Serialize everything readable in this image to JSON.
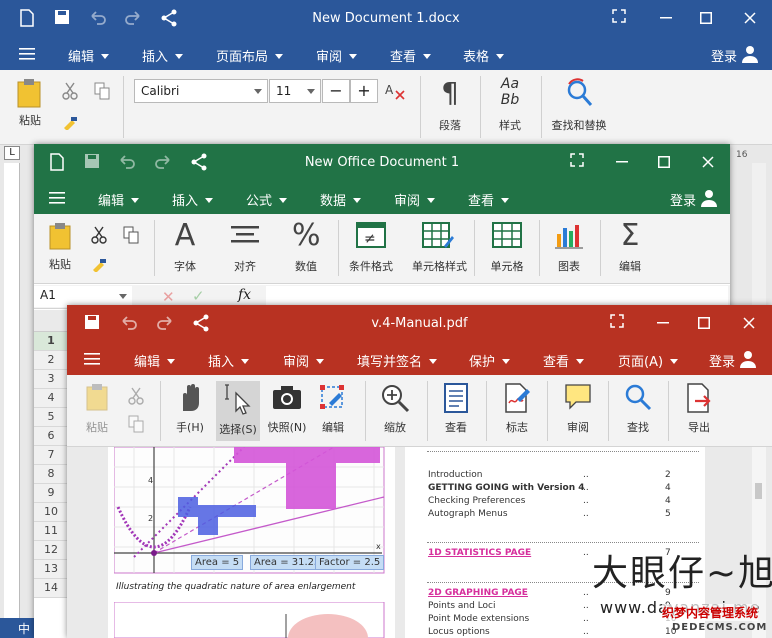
{
  "word": {
    "title": "New Document 1.docx",
    "menu": [
      "编辑",
      "插入",
      "页面布局",
      "审阅",
      "查看",
      "表格"
    ],
    "login": "登录",
    "paste": "粘贴",
    "font_name": "Calibri",
    "font_size": "11",
    "para": "段落",
    "styles": "样式",
    "find": "查找和替换",
    "styles_glyph": "Aa\nBb",
    "ruler_num": "16",
    "status_left": "中"
  },
  "excel": {
    "title": "New Office Document 1",
    "menu": [
      "编辑",
      "插入",
      "公式",
      "数据",
      "审阅",
      "查看"
    ],
    "login": "登录",
    "tools": [
      "粘贴",
      "字体",
      "对齐",
      "数值",
      "条件格式",
      "单元格样式",
      "单元格",
      "图表",
      "编辑"
    ],
    "cell_ref": "A1",
    "fx": "fx",
    "rows": [
      "1",
      "2",
      "3",
      "4",
      "5",
      "6",
      "7",
      "8",
      "9",
      "10",
      "11",
      "12",
      "13",
      "14"
    ]
  },
  "pdf": {
    "title": "v.4-Manual.pdf",
    "menu": [
      "编辑",
      "插入",
      "审阅",
      "填写并签名",
      "保护",
      "查看",
      "页面(A)"
    ],
    "login": "登录",
    "tools": [
      "粘贴",
      "手(H)",
      "选择(S)",
      "快照(N)",
      "编辑",
      "缩放",
      "查看",
      "标志",
      "审阅",
      "查找",
      "导出"
    ],
    "caption": "Illustrating the quadratic nature of area enlargement",
    "labels": [
      "Area = 5",
      "Area = 31.25",
      "Factor = 2.5"
    ],
    "axis": [
      "4",
      "2",
      "x"
    ],
    "toc": [
      {
        "text": "Introduction",
        "dots": "..",
        "page": "2",
        "style": "normal"
      },
      {
        "text": "GETTING GOING with Version 4",
        "dots": "..",
        "page": "4",
        "style": "bold"
      },
      {
        "text": "Checking Preferences",
        "dots": "..",
        "page": "4",
        "style": "normal"
      },
      {
        "text": "Autograph Menus",
        "dots": "..",
        "page": "5",
        "style": "normal"
      },
      {
        "text": "1D STATISTICS PAGE",
        "dots": "..",
        "page": "7",
        "style": "header"
      },
      {
        "text": "2D GRAPHING PAGE",
        "dots": "..",
        "page": "9",
        "style": "header"
      },
      {
        "text": "Points and Loci",
        "dots": "..",
        "page": "9",
        "style": "normal"
      },
      {
        "text": "Point Mode extensions",
        "dots": "..",
        "page": "10",
        "style": "normal"
      },
      {
        "text": "Locus options",
        "dots": "..",
        "page": "10",
        "style": "normal"
      }
    ]
  },
  "watermark": {
    "big": "大眼仔~旭",
    "url": "www.dayanzai.me",
    "site": "织梦内容管理系统",
    "domain": "DEDECMS.COM"
  },
  "colors": {
    "word": "#2b579a",
    "excel": "#217346",
    "pdf": "#b83222"
  }
}
